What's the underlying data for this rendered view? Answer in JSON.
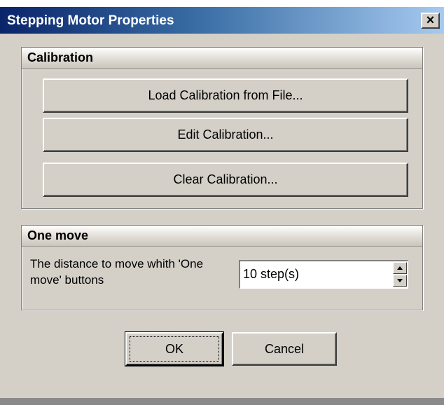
{
  "window": {
    "title": "Stepping Motor Properties",
    "close_label": "×"
  },
  "calibration": {
    "title": "Calibration",
    "load_label": "Load Calibration from File...",
    "edit_label": "Edit Calibration...",
    "clear_label": "Clear Calibration..."
  },
  "one_move": {
    "title": "One move",
    "label": "The distance to move whith 'One move' buttons",
    "value": "10 step(s)"
  },
  "buttons": {
    "ok": "OK",
    "cancel": "Cancel"
  },
  "colors": {
    "face": "#d4d0c8",
    "titlebar_start": "#0a246a",
    "titlebar_end": "#a6caf0"
  },
  "icons": {
    "close": "close-icon",
    "spin_up": "up-arrow-icon",
    "spin_down": "down-arrow-icon"
  }
}
